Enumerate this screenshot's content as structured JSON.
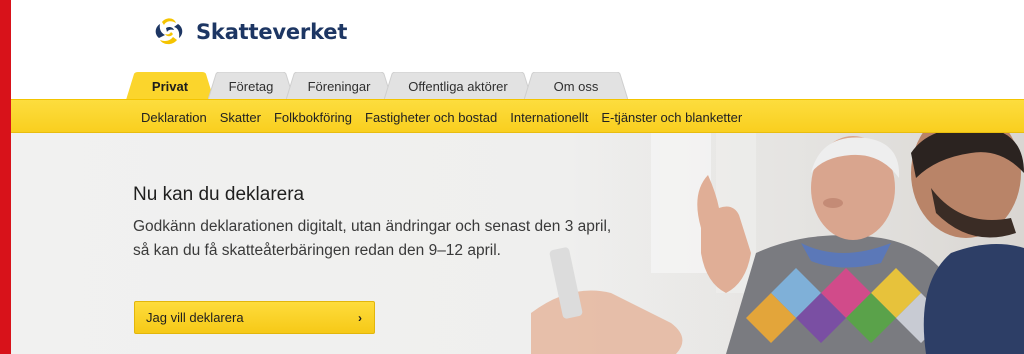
{
  "brand": {
    "name": "Skatteverket"
  },
  "tabs": [
    {
      "label": "Privat",
      "active": true
    },
    {
      "label": "Företag",
      "active": false
    },
    {
      "label": "Föreningar",
      "active": false
    },
    {
      "label": "Offentliga aktörer",
      "active": false
    },
    {
      "label": "Om oss",
      "active": false
    }
  ],
  "subnav": [
    "Deklaration",
    "Skatter",
    "Folkbokföring",
    "Fastigheter och bostad",
    "Internationellt",
    "E-tjänster och blanketter"
  ],
  "hero": {
    "title": "Nu kan du deklarera",
    "body": "Godkänn deklarationen digitalt, utan ändringar och senast den 3 april, så kan du få skatteåterbäringen redan den 9–12 april.",
    "cta_label": "Jag vill deklarera",
    "cta_icon": "chevron-right-icon"
  },
  "colors": {
    "accent_red": "#d8121a",
    "brand_blue": "#1d3663",
    "nav_yellow": "#fbd52c"
  }
}
